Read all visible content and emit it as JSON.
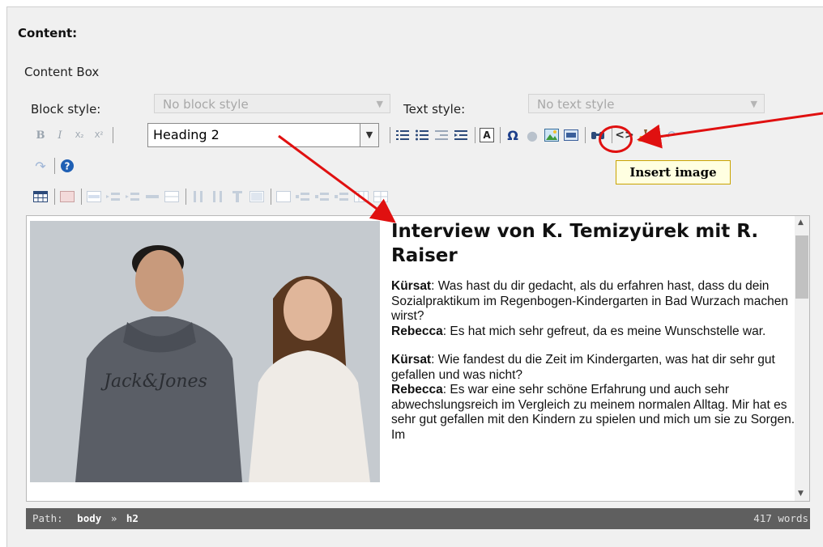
{
  "section": {
    "title": "Content:",
    "box_label": "Content Box"
  },
  "styles": {
    "block_label": "Block style:",
    "block_value": "No block style",
    "text_label": "Text style:",
    "text_value": "No text style"
  },
  "format": {
    "value": "Heading 2"
  },
  "toolbar": {
    "bold": "B",
    "italic": "I",
    "sub": "X₂",
    "sup": "X²",
    "font_color": "A",
    "special_char": "Ω",
    "tooltip": "Insert image",
    "icons": [
      "bold-icon",
      "italic-icon",
      "subscript-icon",
      "superscript-icon",
      "numbered-list-icon",
      "bullet-list-icon",
      "outdent-icon",
      "indent-icon",
      "font-color-icon",
      "special-character-icon",
      "insert-link-icon",
      "insert-image-icon",
      "insert-media-icon",
      "find-replace-icon",
      "source-code-icon",
      "clean-format-icon",
      "undo-icon",
      "redo-icon",
      "help-icon",
      "table-icon"
    ]
  },
  "editor": {
    "heading": "Interview von K. Temizyürek mit R. Raiser",
    "paragraphs": [
      {
        "speaker1": "Kürsat",
        "text1": ": Was hast du dir gedacht, als du erfahren hast, dass du dein Sozialpraktikum im Regenbogen-Kindergarten in Bad Wurzach machen wirst?",
        "speaker2": "Rebecca",
        "text2": ": Es hat mich sehr gefreut, da es meine Wunschstelle war."
      },
      {
        "speaker1": "Kürsat",
        "text1": ": Wie fandest du die Zeit im Kindergarten, was hat dir sehr gut gefallen und was nicht?",
        "speaker2": "Rebecca",
        "text2": ": Es war eine sehr schöne Erfahrung und auch sehr abwechslungsreich im Vergleich zu meinem normalen Alltag. Mir hat es sehr gut gefallen mit den Kindern zu spielen und mich um sie zu Sorgen. Im"
      }
    ]
  },
  "statusbar": {
    "path_label": "Path:",
    "path_body": "body",
    "path_sep": "»",
    "path_h2": "h2",
    "word_count": "417 words"
  },
  "colors": {
    "annotation_red": "#e01010",
    "tooltip_bg": "#ffffe1",
    "statusbar_bg": "#5f5f5f"
  }
}
